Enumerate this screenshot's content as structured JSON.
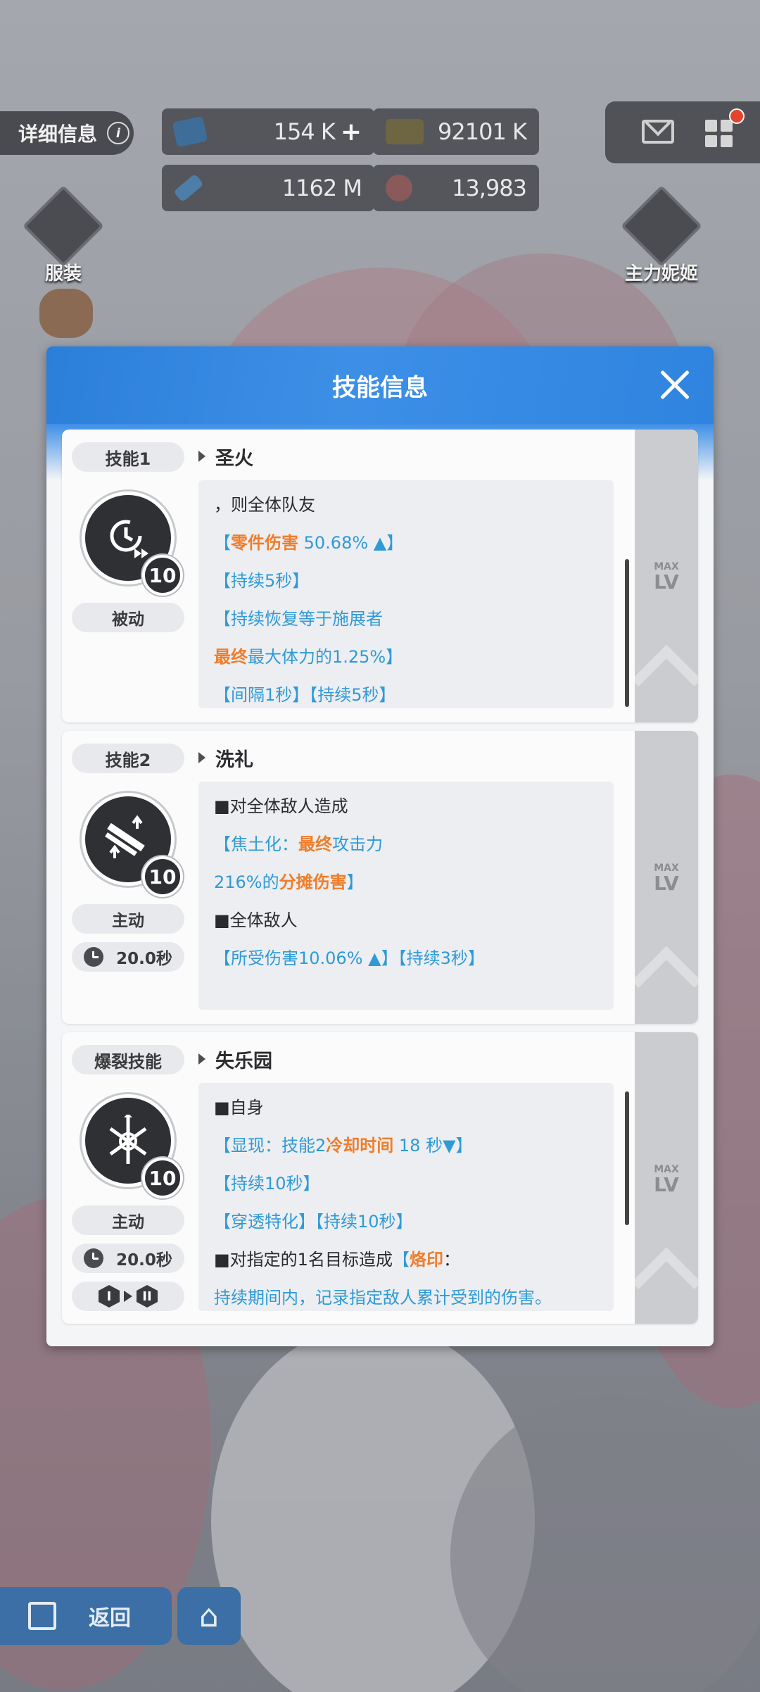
{
  "hud": {
    "detail_tab": "详细信息",
    "info_glyph": "i",
    "res_1": "154 K",
    "res_1_plus": "+",
    "res_2": "92101 K",
    "res_3": "1162 M",
    "res_4": "13,983",
    "costume_label": "服装",
    "main_nikke_label": "主力妮姬"
  },
  "modal": {
    "title": "技能信息"
  },
  "skills": [
    {
      "tag": "技能1",
      "name": "圣火",
      "level": "10",
      "type": "被动",
      "max_label": "MAX",
      "lv_label": "LV",
      "lines": [
        {
          "parts": [
            {
              "t": "，则全体队友",
              "c": ""
            }
          ]
        },
        {
          "parts": [
            {
              "t": "【",
              "c": "b"
            },
            {
              "t": "零件伤害",
              "c": "o"
            },
            {
              "t": " 50.68% ▲】",
              "c": "b"
            }
          ]
        },
        {
          "parts": [
            {
              "t": "【持续5秒】",
              "c": "b"
            }
          ]
        },
        {
          "parts": [
            {
              "t": "【持续恢复等于施展者",
              "c": "b"
            }
          ]
        },
        {
          "parts": [
            {
              "t": "最终",
              "c": "o"
            },
            {
              "t": "最大体力的1.25%】",
              "c": "b"
            }
          ]
        },
        {
          "parts": [
            {
              "t": "【间隔1秒】【持续5秒】",
              "c": "b"
            }
          ]
        }
      ]
    },
    {
      "tag": "技能2",
      "name": "洗礼",
      "level": "10",
      "type": "主动",
      "cooldown": "20.0秒",
      "max_label": "MAX",
      "lv_label": "LV",
      "lines": [
        {
          "parts": [
            {
              "t": "■对全体敌人造成",
              "c": ""
            }
          ]
        },
        {
          "parts": [
            {
              "t": "【焦土化：",
              "c": "b"
            },
            {
              "t": "最终",
              "c": "o"
            },
            {
              "t": "攻击力",
              "c": "b"
            }
          ]
        },
        {
          "parts": [
            {
              "t": "216%的",
              "c": "b"
            },
            {
              "t": "分摊伤害",
              "c": "o"
            },
            {
              "t": "】",
              "c": "b"
            }
          ]
        },
        {
          "parts": [
            {
              "t": "■全体敌人",
              "c": ""
            }
          ]
        },
        {
          "parts": [
            {
              "t": "【所受伤害10.06% ▲】【持续3秒】",
              "c": "b"
            }
          ]
        }
      ]
    },
    {
      "tag": "爆裂技能",
      "name": "失乐园",
      "level": "10",
      "type": "主动",
      "cooldown": "20.0秒",
      "burst_from": "I",
      "burst_to": "II",
      "max_label": "MAX",
      "lv_label": "LV",
      "lines": [
        {
          "parts": [
            {
              "t": "■自身",
              "c": ""
            }
          ]
        },
        {
          "parts": [
            {
              "t": "【显现：技能2",
              "c": "b"
            },
            {
              "t": "冷却时间",
              "c": "o"
            },
            {
              "t": " 18 秒▼】",
              "c": "b"
            }
          ]
        },
        {
          "parts": [
            {
              "t": "【持续10秒】",
              "c": "b"
            }
          ]
        },
        {
          "parts": [
            {
              "t": "【穿透特化】【持续10秒】",
              "c": "b"
            }
          ]
        },
        {
          "parts": [
            {
              "t": "■对指定的1名目标造成",
              "c": ""
            },
            {
              "t": "【",
              "c": "b"
            },
            {
              "t": "烙印",
              "c": "o"
            },
            {
              "t": "：",
              "c": ""
            }
          ]
        },
        {
          "parts": [
            {
              "t": "持续期间内，记录指定敌人累计受到的伤害。",
              "c": "b"
            }
          ]
        }
      ]
    }
  ],
  "footer": {
    "back_label": "返回"
  },
  "colors": {
    "accent_blue": "#2f84df",
    "highlight_orange": "#f07d2a",
    "text_cyan": "#2f9ad6"
  }
}
